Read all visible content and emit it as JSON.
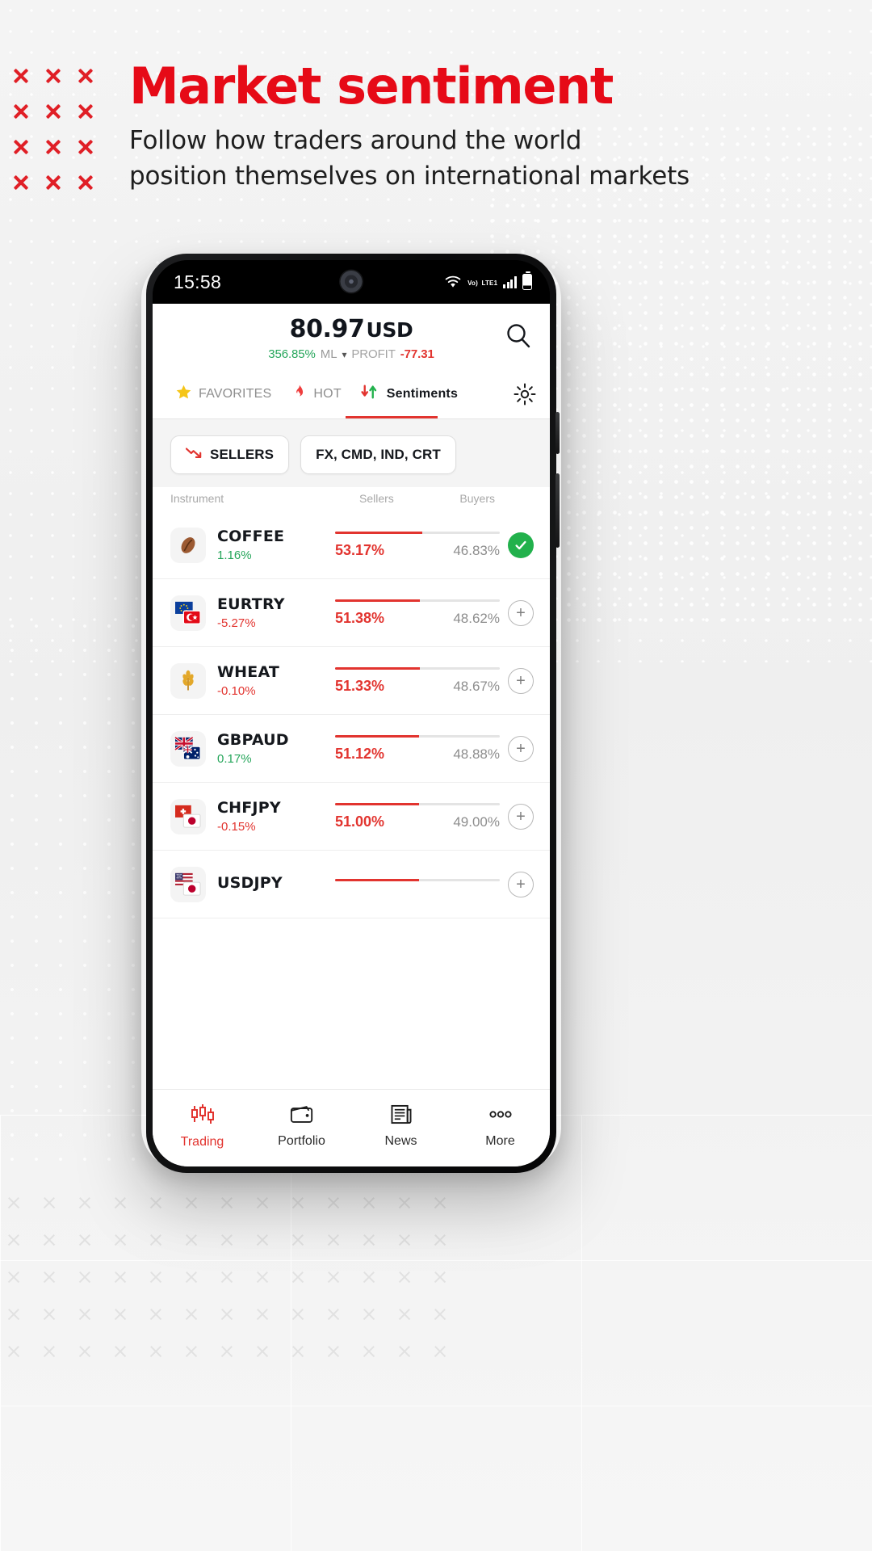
{
  "promo": {
    "headline": "Market sentiment",
    "subtitle_line1": "Follow how traders around the world",
    "subtitle_line2": "position themselves on international markets",
    "accent_color": "#e60a17",
    "decoration_icon": "x-mark-icon"
  },
  "status_bar": {
    "time": "15:58",
    "wifi_icon": "wifi-icon",
    "volte_icon": "volte-icon",
    "volte_label_top": "Vo)",
    "volte_label_bottom": "LTE1",
    "signal_icon": "signal-bars-icon",
    "battery_icon": "battery-icon"
  },
  "account": {
    "balance": "80.97",
    "currency": "USD",
    "margin_level": "356.85%",
    "margin_level_label": "ML",
    "dropdown_icon": "chevron-down-icon",
    "profit_label": "PROFIT",
    "profit_value": "-77.31",
    "search_icon": "search-icon"
  },
  "tabs": [
    {
      "label": "FAVORITES",
      "icon": "star-icon",
      "active": false
    },
    {
      "label": "HOT",
      "icon": "flame-icon",
      "active": false
    },
    {
      "label": "Sentiments",
      "icon": "sentiment-arrows-icon",
      "active": true
    }
  ],
  "settings_icon": "gear-icon",
  "filters": [
    {
      "label": "SELLERS",
      "icon": "trend-down-icon"
    },
    {
      "label": "FX, CMD, IND, CRT",
      "icon": "none"
    }
  ],
  "table": {
    "headers": {
      "instrument": "Instrument",
      "sellers": "Sellers",
      "buyers": "Buyers"
    },
    "rows": [
      {
        "symbol": "COFFEE",
        "change": "1.16%",
        "change_dir": "up",
        "sellers_pct": "53.17%",
        "buyers_pct": "46.83%",
        "sellers_value": 53.17,
        "icon": "coffee-bean-icon",
        "action": "check",
        "action_icon": "check-icon"
      },
      {
        "symbol": "EURTRY",
        "change": "-5.27%",
        "change_dir": "down",
        "sellers_pct": "51.38%",
        "buyers_pct": "48.62%",
        "sellers_value": 51.38,
        "icon": "eur-try-flag-icon",
        "action": "plus",
        "action_icon": "plus-icon"
      },
      {
        "symbol": "WHEAT",
        "change": "-0.10%",
        "change_dir": "down",
        "sellers_pct": "51.33%",
        "buyers_pct": "48.67%",
        "sellers_value": 51.33,
        "icon": "wheat-icon",
        "action": "plus",
        "action_icon": "plus-icon"
      },
      {
        "symbol": "GBPAUD",
        "change": "0.17%",
        "change_dir": "up",
        "sellers_pct": "51.12%",
        "buyers_pct": "48.88%",
        "sellers_value": 51.12,
        "icon": "gbp-aud-flag-icon",
        "action": "plus",
        "action_icon": "plus-icon"
      },
      {
        "symbol": "CHFJPY",
        "change": "-0.15%",
        "change_dir": "down",
        "sellers_pct": "51.00%",
        "buyers_pct": "49.00%",
        "sellers_value": 51.0,
        "icon": "chf-jpy-flag-icon",
        "action": "plus",
        "action_icon": "plus-icon"
      },
      {
        "symbol": "USDJPY",
        "change": "",
        "change_dir": "up",
        "sellers_pct": "",
        "buyers_pct": "",
        "sellers_value": 51.0,
        "icon": "usd-jpy-flag-icon",
        "action": "plus",
        "action_icon": "plus-icon"
      }
    ]
  },
  "bottom_nav": [
    {
      "label": "Trading",
      "icon": "candlestick-icon",
      "active": true
    },
    {
      "label": "Portfolio",
      "icon": "wallet-icon",
      "active": false
    },
    {
      "label": "News",
      "icon": "newspaper-icon",
      "active": false
    },
    {
      "label": "More",
      "icon": "more-dots-icon",
      "active": false
    }
  ],
  "system_nav": {
    "recents_icon": "recents-icon",
    "home_icon": "home-icon",
    "back_icon": "back-icon"
  },
  "colors": {
    "red": "#e2342f",
    "green": "#26a65b",
    "brand_red": "#e60a17"
  }
}
